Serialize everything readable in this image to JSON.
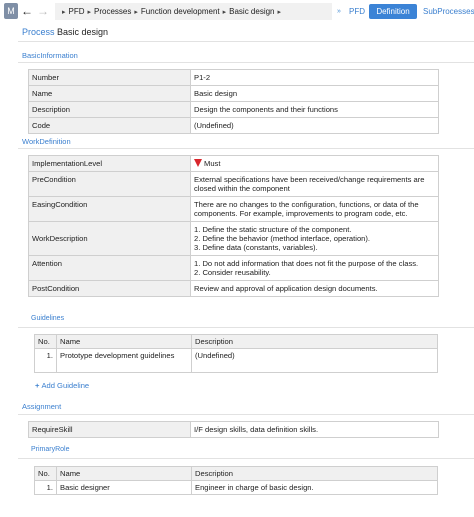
{
  "toolbar": {
    "badge": "M",
    "back_glyph": "←",
    "forward_glyph": "→",
    "breadcrumb": [
      {
        "label": "PFD"
      },
      {
        "label": "Processes"
      },
      {
        "label": "Function development"
      },
      {
        "label": "Basic design"
      }
    ],
    "separator_glyph": "▸",
    "tabs_separator_glyph": "»",
    "tabs": [
      {
        "label": "PFD",
        "active": false
      },
      {
        "label": "Definition",
        "active": true
      },
      {
        "label": "SubProcesses",
        "active": false
      }
    ]
  },
  "page": {
    "kind": "Process",
    "name": "Basic design"
  },
  "basic_information": {
    "header": "BasicInformation",
    "rows": [
      {
        "key": "Number",
        "value": "P1-2"
      },
      {
        "key": "Name",
        "value": "Basic design"
      },
      {
        "key": "Description",
        "value": "Design the components and their functions"
      },
      {
        "key": "Code",
        "value": "(Undefined)"
      }
    ]
  },
  "work_definition": {
    "header": "WorkDefinition",
    "rows": [
      {
        "key": "ImplementationLevel",
        "value": "Must"
      },
      {
        "key": "PreCondition",
        "value": "External specifications have been received/change requirements are closed within the component"
      },
      {
        "key": "EasingCondition",
        "value": "There are no changes to the configuration, functions, or data of the components. For example, improvements to program code, etc."
      },
      {
        "key": "WorkDescription",
        "value": "1. Define the static structure of the component.\n2. Define the behavior (method interface, operation).\n3. Define data (constants, variables)."
      },
      {
        "key": "Attention",
        "value": "1. Do not add information that does not fit the purpose of the class.\n2. Consider reusability."
      },
      {
        "key": "PostCondition",
        "value": "Review and approval of application design documents."
      }
    ]
  },
  "guidelines": {
    "header": "Guidelines",
    "columns": [
      "No.",
      "Name",
      "Description"
    ],
    "rows": [
      {
        "no": "1.",
        "name": "Prototype development guidelines",
        "description": "(Undefined)"
      }
    ],
    "add_label": "Add Guideline"
  },
  "assignment": {
    "header": "Assignment",
    "rows": [
      {
        "key": "RequireSkill",
        "value": "I/F design skills, data definition skills."
      }
    ]
  },
  "primary_role": {
    "header": "PrimaryRole",
    "columns": [
      "No.",
      "Name",
      "Description"
    ],
    "rows": [
      {
        "no": "1.",
        "name": "Basic designer",
        "description": "Engineer in charge of basic design."
      }
    ]
  },
  "colors": {
    "accent": "#3a7fcf",
    "active_tab": "#3b83d6",
    "flag_red": "#d9262c",
    "label_bg": "#f0f0f0",
    "border": "#cfcfcf"
  }
}
